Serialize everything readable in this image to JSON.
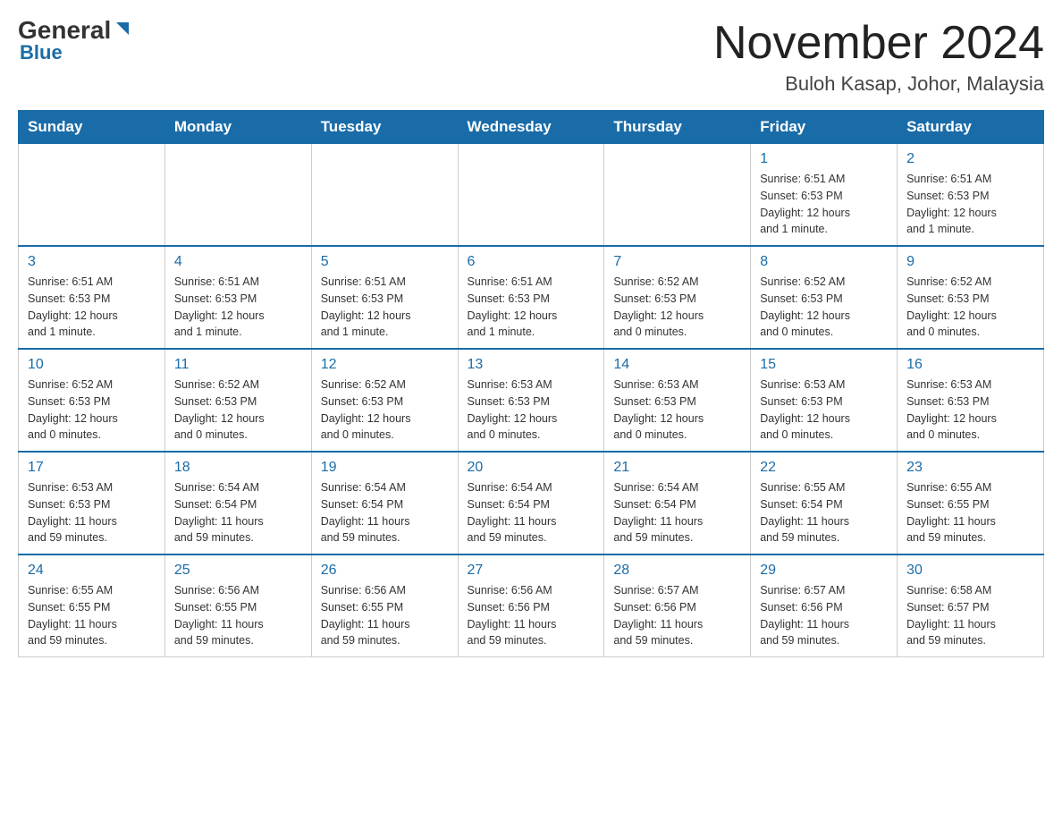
{
  "header": {
    "logo_general": "General",
    "logo_blue": "Blue",
    "month_title": "November 2024",
    "location": "Buloh Kasap, Johor, Malaysia"
  },
  "days_of_week": [
    "Sunday",
    "Monday",
    "Tuesday",
    "Wednesday",
    "Thursday",
    "Friday",
    "Saturday"
  ],
  "weeks": [
    [
      {
        "day": "",
        "info": ""
      },
      {
        "day": "",
        "info": ""
      },
      {
        "day": "",
        "info": ""
      },
      {
        "day": "",
        "info": ""
      },
      {
        "day": "",
        "info": ""
      },
      {
        "day": "1",
        "info": "Sunrise: 6:51 AM\nSunset: 6:53 PM\nDaylight: 12 hours\nand 1 minute."
      },
      {
        "day": "2",
        "info": "Sunrise: 6:51 AM\nSunset: 6:53 PM\nDaylight: 12 hours\nand 1 minute."
      }
    ],
    [
      {
        "day": "3",
        "info": "Sunrise: 6:51 AM\nSunset: 6:53 PM\nDaylight: 12 hours\nand 1 minute."
      },
      {
        "day": "4",
        "info": "Sunrise: 6:51 AM\nSunset: 6:53 PM\nDaylight: 12 hours\nand 1 minute."
      },
      {
        "day": "5",
        "info": "Sunrise: 6:51 AM\nSunset: 6:53 PM\nDaylight: 12 hours\nand 1 minute."
      },
      {
        "day": "6",
        "info": "Sunrise: 6:51 AM\nSunset: 6:53 PM\nDaylight: 12 hours\nand 1 minute."
      },
      {
        "day": "7",
        "info": "Sunrise: 6:52 AM\nSunset: 6:53 PM\nDaylight: 12 hours\nand 0 minutes."
      },
      {
        "day": "8",
        "info": "Sunrise: 6:52 AM\nSunset: 6:53 PM\nDaylight: 12 hours\nand 0 minutes."
      },
      {
        "day": "9",
        "info": "Sunrise: 6:52 AM\nSunset: 6:53 PM\nDaylight: 12 hours\nand 0 minutes."
      }
    ],
    [
      {
        "day": "10",
        "info": "Sunrise: 6:52 AM\nSunset: 6:53 PM\nDaylight: 12 hours\nand 0 minutes."
      },
      {
        "day": "11",
        "info": "Sunrise: 6:52 AM\nSunset: 6:53 PM\nDaylight: 12 hours\nand 0 minutes."
      },
      {
        "day": "12",
        "info": "Sunrise: 6:52 AM\nSunset: 6:53 PM\nDaylight: 12 hours\nand 0 minutes."
      },
      {
        "day": "13",
        "info": "Sunrise: 6:53 AM\nSunset: 6:53 PM\nDaylight: 12 hours\nand 0 minutes."
      },
      {
        "day": "14",
        "info": "Sunrise: 6:53 AM\nSunset: 6:53 PM\nDaylight: 12 hours\nand 0 minutes."
      },
      {
        "day": "15",
        "info": "Sunrise: 6:53 AM\nSunset: 6:53 PM\nDaylight: 12 hours\nand 0 minutes."
      },
      {
        "day": "16",
        "info": "Sunrise: 6:53 AM\nSunset: 6:53 PM\nDaylight: 12 hours\nand 0 minutes."
      }
    ],
    [
      {
        "day": "17",
        "info": "Sunrise: 6:53 AM\nSunset: 6:53 PM\nDaylight: 11 hours\nand 59 minutes."
      },
      {
        "day": "18",
        "info": "Sunrise: 6:54 AM\nSunset: 6:54 PM\nDaylight: 11 hours\nand 59 minutes."
      },
      {
        "day": "19",
        "info": "Sunrise: 6:54 AM\nSunset: 6:54 PM\nDaylight: 11 hours\nand 59 minutes."
      },
      {
        "day": "20",
        "info": "Sunrise: 6:54 AM\nSunset: 6:54 PM\nDaylight: 11 hours\nand 59 minutes."
      },
      {
        "day": "21",
        "info": "Sunrise: 6:54 AM\nSunset: 6:54 PM\nDaylight: 11 hours\nand 59 minutes."
      },
      {
        "day": "22",
        "info": "Sunrise: 6:55 AM\nSunset: 6:54 PM\nDaylight: 11 hours\nand 59 minutes."
      },
      {
        "day": "23",
        "info": "Sunrise: 6:55 AM\nSunset: 6:55 PM\nDaylight: 11 hours\nand 59 minutes."
      }
    ],
    [
      {
        "day": "24",
        "info": "Sunrise: 6:55 AM\nSunset: 6:55 PM\nDaylight: 11 hours\nand 59 minutes."
      },
      {
        "day": "25",
        "info": "Sunrise: 6:56 AM\nSunset: 6:55 PM\nDaylight: 11 hours\nand 59 minutes."
      },
      {
        "day": "26",
        "info": "Sunrise: 6:56 AM\nSunset: 6:55 PM\nDaylight: 11 hours\nand 59 minutes."
      },
      {
        "day": "27",
        "info": "Sunrise: 6:56 AM\nSunset: 6:56 PM\nDaylight: 11 hours\nand 59 minutes."
      },
      {
        "day": "28",
        "info": "Sunrise: 6:57 AM\nSunset: 6:56 PM\nDaylight: 11 hours\nand 59 minutes."
      },
      {
        "day": "29",
        "info": "Sunrise: 6:57 AM\nSunset: 6:56 PM\nDaylight: 11 hours\nand 59 minutes."
      },
      {
        "day": "30",
        "info": "Sunrise: 6:58 AM\nSunset: 6:57 PM\nDaylight: 11 hours\nand 59 minutes."
      }
    ]
  ]
}
